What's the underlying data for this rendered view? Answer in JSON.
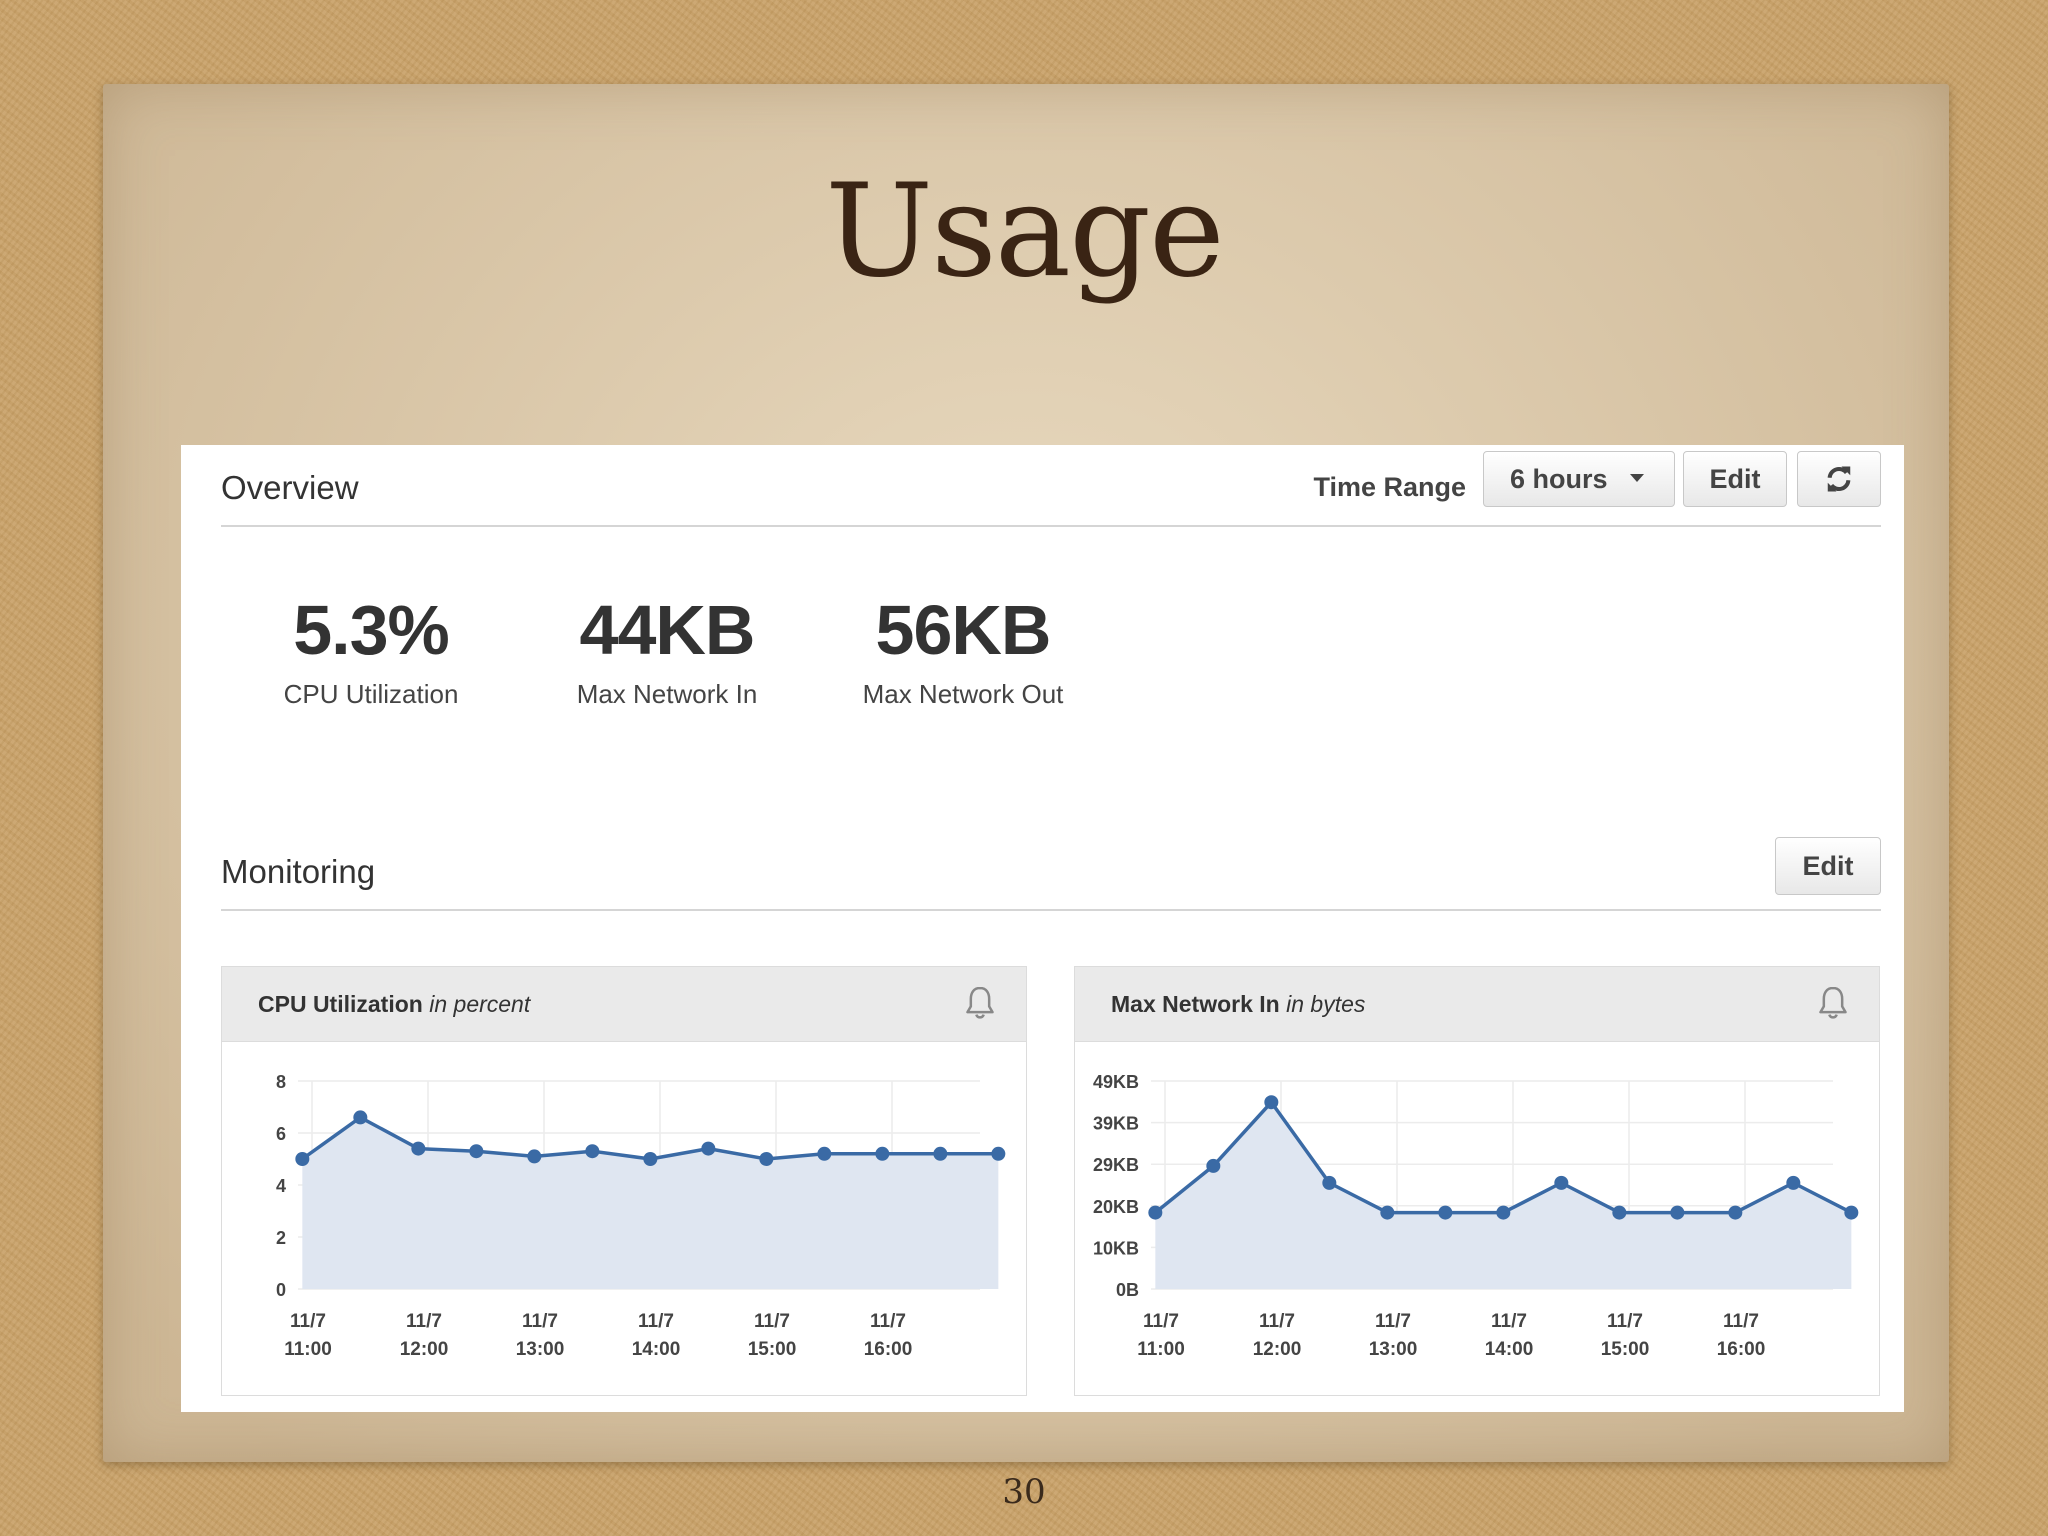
{
  "slide": {
    "title": "Usage",
    "page_number": "30"
  },
  "overview": {
    "title": "Overview",
    "time_range_label": "Time Range",
    "time_range_value": "6 hours",
    "edit_label": "Edit",
    "refresh_icon": "refresh-icon"
  },
  "stats": [
    {
      "value": "5.3%",
      "label": "CPU Utilization"
    },
    {
      "value": "44KB",
      "label": "Max Network In"
    },
    {
      "value": "56KB",
      "label": "Max Network Out"
    }
  ],
  "monitoring": {
    "title": "Monitoring",
    "edit_label": "Edit"
  },
  "colors": {
    "line": "#3a6aa5",
    "fill": "#dfe6f1",
    "grid": "#ececec"
  },
  "chart_data": [
    {
      "type": "area",
      "title_bold": "CPU Utilization",
      "title_unit": "in percent",
      "alarm_icon": "bell-icon",
      "x_ticks": [
        [
          "11/7",
          "11:00"
        ],
        [
          "11/7",
          "12:00"
        ],
        [
          "11/7",
          "13:00"
        ],
        [
          "11/7",
          "14:00"
        ],
        [
          "11/7",
          "15:00"
        ],
        [
          "11/7",
          "16:00"
        ]
      ],
      "y_ticks": [
        "0",
        "2",
        "4",
        "6",
        "8"
      ],
      "ylim": [
        0,
        8
      ],
      "x": [
        "11/7 10:55",
        "11/7 11:25",
        "11/7 11:55",
        "11/7 12:25",
        "11/7 12:55",
        "11/7 13:25",
        "11/7 13:55",
        "11/7 14:25",
        "11/7 14:55",
        "11/7 15:25",
        "11/7 15:55",
        "11/7 16:25",
        "11/7 16:55"
      ],
      "values": [
        5.0,
        6.6,
        5.4,
        5.3,
        5.1,
        5.3,
        5.0,
        5.4,
        5.0,
        5.2,
        5.2,
        5.2,
        5.2
      ],
      "grid": true
    },
    {
      "type": "area",
      "title_bold": "Max Network In",
      "title_unit": "in bytes",
      "alarm_icon": "bell-icon",
      "x_ticks": [
        [
          "11/7",
          "11:00"
        ],
        [
          "11/7",
          "12:00"
        ],
        [
          "11/7",
          "13:00"
        ],
        [
          "11/7",
          "14:00"
        ],
        [
          "11/7",
          "15:00"
        ],
        [
          "11/7",
          "16:00"
        ]
      ],
      "y_ticks": [
        "0B",
        "10KB",
        "20KB",
        "29KB",
        "39KB",
        "49KB"
      ],
      "ylim": [
        0,
        49
      ],
      "x": [
        "11/7 10:55",
        "11/7 11:25",
        "11/7 11:55",
        "11/7 12:25",
        "11/7 12:55",
        "11/7 13:25",
        "11/7 13:55",
        "11/7 14:25",
        "11/7 14:55",
        "11/7 15:25",
        "11/7 15:55",
        "11/7 16:25",
        "11/7 16:55"
      ],
      "values": [
        18,
        29,
        44,
        25,
        18,
        18,
        18,
        25,
        18,
        18,
        18,
        25,
        18
      ],
      "grid": true
    }
  ]
}
